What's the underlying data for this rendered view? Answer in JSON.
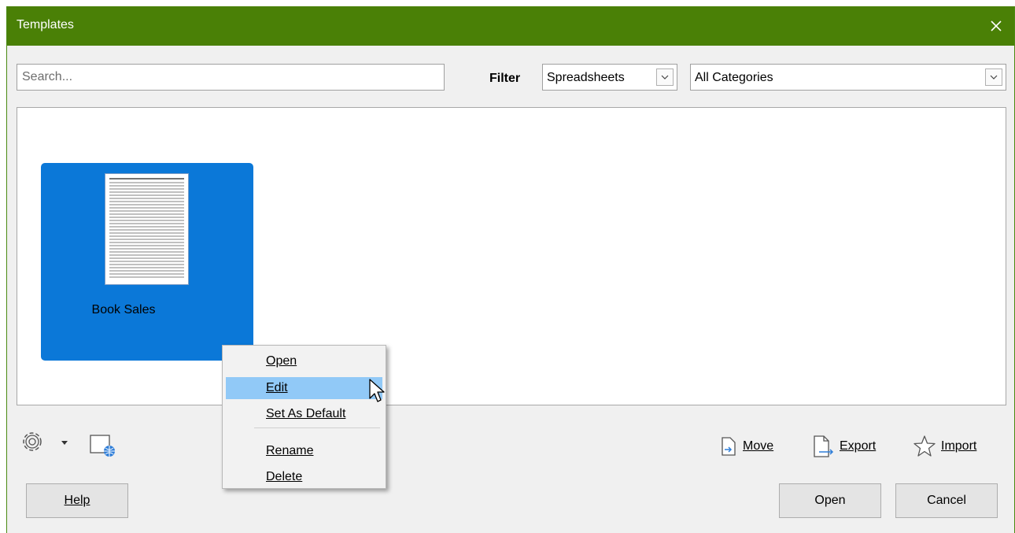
{
  "window": {
    "title": "Templates"
  },
  "search": {
    "placeholder": "Search...",
    "value": ""
  },
  "filter": {
    "label": "Filter",
    "type_selected": "Spreadsheets",
    "category_selected": "All Categories"
  },
  "templates": [
    {
      "name": "Book Sales",
      "selected": true
    }
  ],
  "context_menu": {
    "items": [
      {
        "label": "Open",
        "highlighted": false
      },
      {
        "label": "Edit",
        "highlighted": true
      },
      {
        "label": "Set As Default",
        "highlighted": false
      },
      {
        "label": "Rename",
        "highlighted": false
      },
      {
        "label": "Delete",
        "highlighted": false
      }
    ]
  },
  "toolbar": {
    "settings_icon": "gear-icon",
    "online_icon": "globe-document-icon",
    "move_label": "Move",
    "export_label": "Export",
    "import_label": "Import"
  },
  "buttons": {
    "help": "Help",
    "open": "Open",
    "cancel": "Cancel"
  },
  "colors": {
    "titlebar": "#4a8006",
    "selection": "#0b78d8",
    "menu_highlight": "#91c9f7"
  }
}
